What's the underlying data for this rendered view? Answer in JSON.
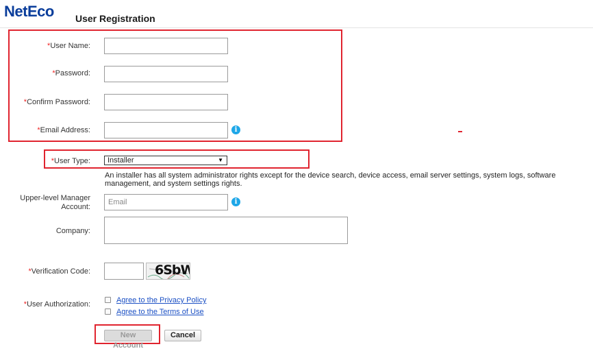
{
  "header": {
    "logo": "NetEco",
    "title": "User Registration"
  },
  "form": {
    "required_mark": "*",
    "username": {
      "label": "User Name:",
      "value": ""
    },
    "password": {
      "label": "Password:",
      "value": ""
    },
    "confirm_password": {
      "label": "Confirm Password:",
      "value": ""
    },
    "email": {
      "label": "Email Address:",
      "value": ""
    },
    "user_type": {
      "label": "User Type:",
      "selected": "Installer",
      "description": "An installer has all system administrator rights except for the device search, device access, email server settings, system logs, software management, and system settings rights."
    },
    "manager_account": {
      "label": "Upper-level Manager Account:",
      "placeholder": "Email",
      "value": ""
    },
    "company": {
      "label": "Company:",
      "value": ""
    },
    "verification": {
      "label": "Verification Code:",
      "value": "",
      "captcha_text": "6SbW"
    },
    "authorization": {
      "label": "User Authorization:",
      "privacy_link": "Agree to the Privacy Policy",
      "terms_link": "Agree to the Terms of Use"
    }
  },
  "buttons": {
    "new_account": "New Account",
    "cancel": "Cancel"
  },
  "colors": {
    "highlight_red": "#e0232e",
    "logo_blue": "#0a3d9b",
    "info_blue": "#1ea7e8",
    "link_blue": "#1a4fc4"
  },
  "icons": {
    "info": "info-circle-icon"
  }
}
